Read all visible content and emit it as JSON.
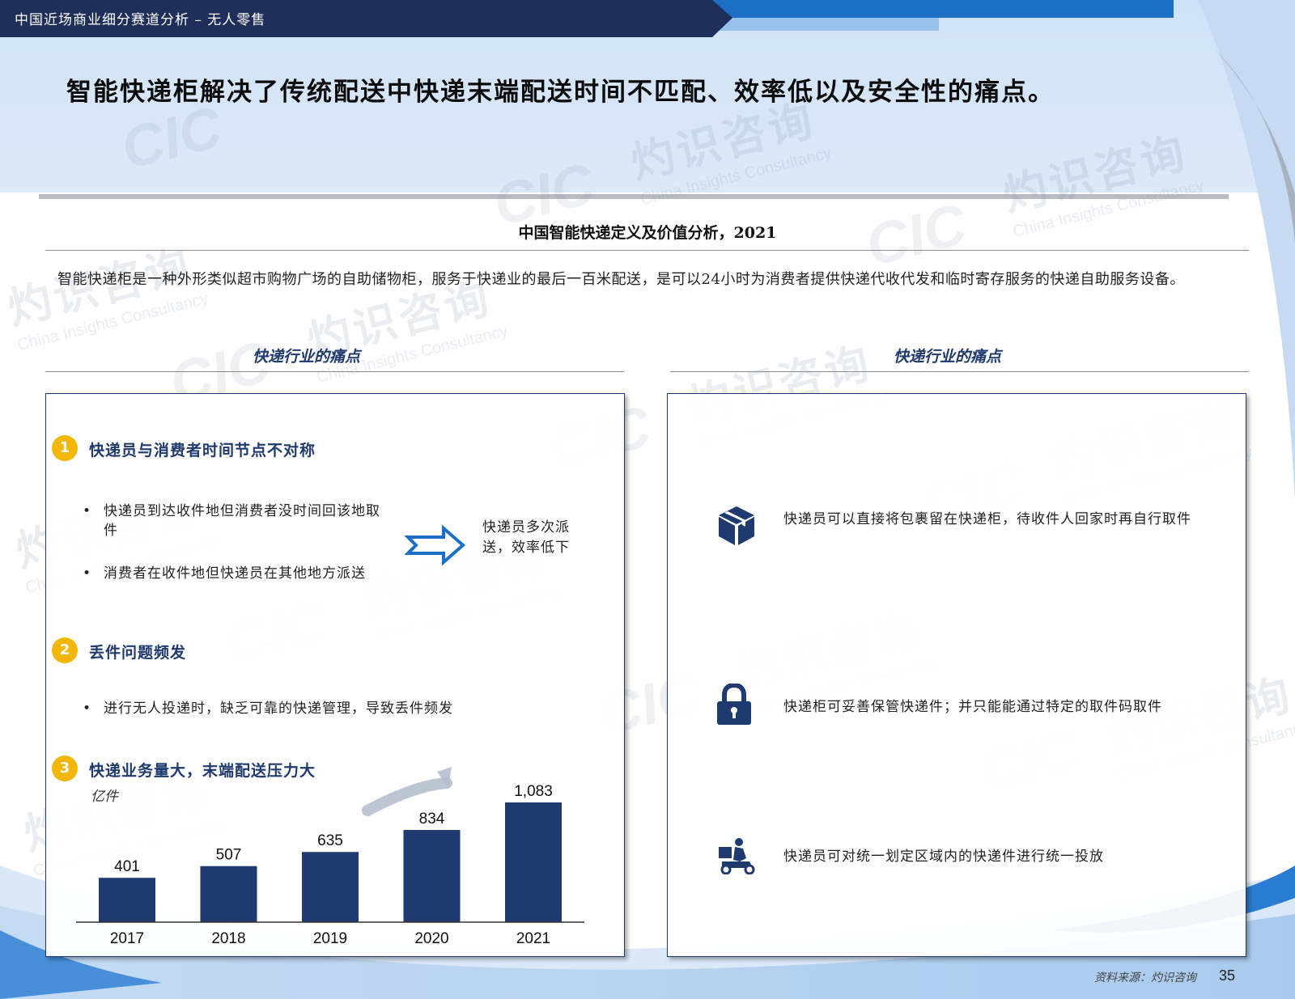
{
  "header": {
    "section_title": "中国近场商业细分赛道分析 – 无人零售",
    "headline": "智能快递柜解决了传统配送中快递末端配送时间不匹配、效率低以及安全性的痛点。"
  },
  "figure_title": "中国智能快递定义及价值分析，2021",
  "definition": "智能快递柜是一种外形类似超市购物广场的自助储物柜，服务于快递业的最后一百米配送，是可以24小时为消费者提供快递代收代发和临时寄存服务的快递自助服务设备。",
  "left_panel": {
    "label": "快递行业的痛点",
    "points": [
      {
        "num": "1",
        "title": "快递员与消费者时间节点不对称",
        "bullets": [
          "快递员到达收件地但消费者没时间回该地取件",
          "消费者在收件地但快递员在其他地方派送"
        ],
        "arrow_text": "快递员多次派送，效率低下"
      },
      {
        "num": "2",
        "title": "丢件问题频发",
        "bullets": [
          "进行无人投递时，缺乏可靠的快递管理，导致丢件频发"
        ]
      },
      {
        "num": "3",
        "title": "快递业务量大，末端配送压力大"
      }
    ]
  },
  "chart_data": {
    "type": "bar",
    "unit_label": "亿件",
    "categories": [
      "2017",
      "2018",
      "2019",
      "2020",
      "2021"
    ],
    "values": [
      401,
      507,
      635,
      834,
      1083
    ],
    "value_labels": [
      "401",
      "507",
      "635",
      "834",
      "1,083"
    ],
    "bar_color": "#1f3a6e"
  },
  "right_panel": {
    "label": "快递行业的痛点",
    "benefits": [
      {
        "icon": "package-icon",
        "text": "快递员可以直接将包裹留在快递柜，待收件人回家时再自行取件"
      },
      {
        "icon": "lock-icon",
        "text": "快递柜可妥善保管快递件；并只能能通过特定的取件码取件"
      },
      {
        "icon": "courier-scooter-icon",
        "text": "快递员可对统一划定区域内的快递件进行统一投放"
      }
    ]
  },
  "footer": {
    "source": "资料来源：灼识咨询",
    "page": "35"
  },
  "watermark": {
    "brand": "CIC",
    "cn": "灼识咨询",
    "en": "China Insights Consultancy"
  },
  "colors": {
    "navy": "#1f3a6e",
    "accent_yellow": "#f2b705",
    "light_blue": "#d3e4f8",
    "mid_blue": "#1c6fc4"
  }
}
